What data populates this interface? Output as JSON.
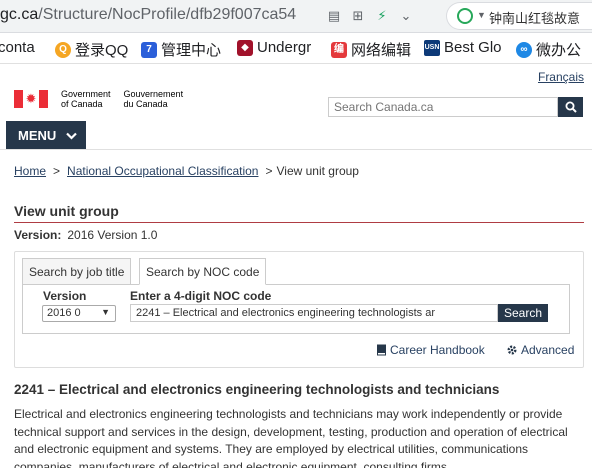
{
  "browser": {
    "url_domain": "gc.ca",
    "url_path": "/Structure/NocProfile/dfb29f007ca54",
    "side_search_text": "钟南山红毯故意",
    "bookmarks": [
      {
        "label": "conta",
        "icon": "bookmark-icon"
      },
      {
        "label": "登录QQ",
        "icon": "qq-icon"
      },
      {
        "label": "管理中心",
        "icon": "admin-icon"
      },
      {
        "label": "Undergr",
        "icon": "shield-icon"
      },
      {
        "label": "网络编辑",
        "icon": "edit-icon"
      },
      {
        "label": "Best Glo",
        "icon": "usn-icon"
      },
      {
        "label": "微办公",
        "icon": "office-icon"
      }
    ]
  },
  "header": {
    "language_link": "Français",
    "gov_en_line1": "Government",
    "gov_en_line2": "of Canada",
    "gov_fr_line1": "Gouvernement",
    "gov_fr_line2": "du Canada",
    "search_placeholder": "Search Canada.ca",
    "menu_label": "MENU"
  },
  "breadcrumb": {
    "home": "Home",
    "noc": "National Occupational Classification",
    "current": "View unit group"
  },
  "main": {
    "page_title": "View unit group",
    "version_label": "Version:",
    "version_value": "2016 Version 1.0",
    "tabs": [
      {
        "label": "Search by job title"
      },
      {
        "label": "Search by NOC code"
      }
    ],
    "version_field_label": "Version",
    "version_select_value": "2016 0",
    "noc_field_label": "Enter a 4-digit NOC code",
    "noc_input_value": "2241 – Electrical and electronics engineering technologists ar",
    "search_button": "Search",
    "career_handbook": "Career Handbook",
    "advanced": "Advanced",
    "unit_title": "2241 – Electrical and electronics engineering technologists and technicians",
    "description": "Electrical and electronics engineering technologists and technicians may work independently or provide technical support and services in the design, development, testing, production and operation of electrical and electronic equipment and systems. They are employed by electrical utilities, communications companies, manufacturers of electrical and electronic equipment, consulting firms"
  },
  "colors": {
    "navy": "#26374a",
    "link": "#284162",
    "rule": "#af3c43",
    "flag_red": "#eb2d37"
  }
}
